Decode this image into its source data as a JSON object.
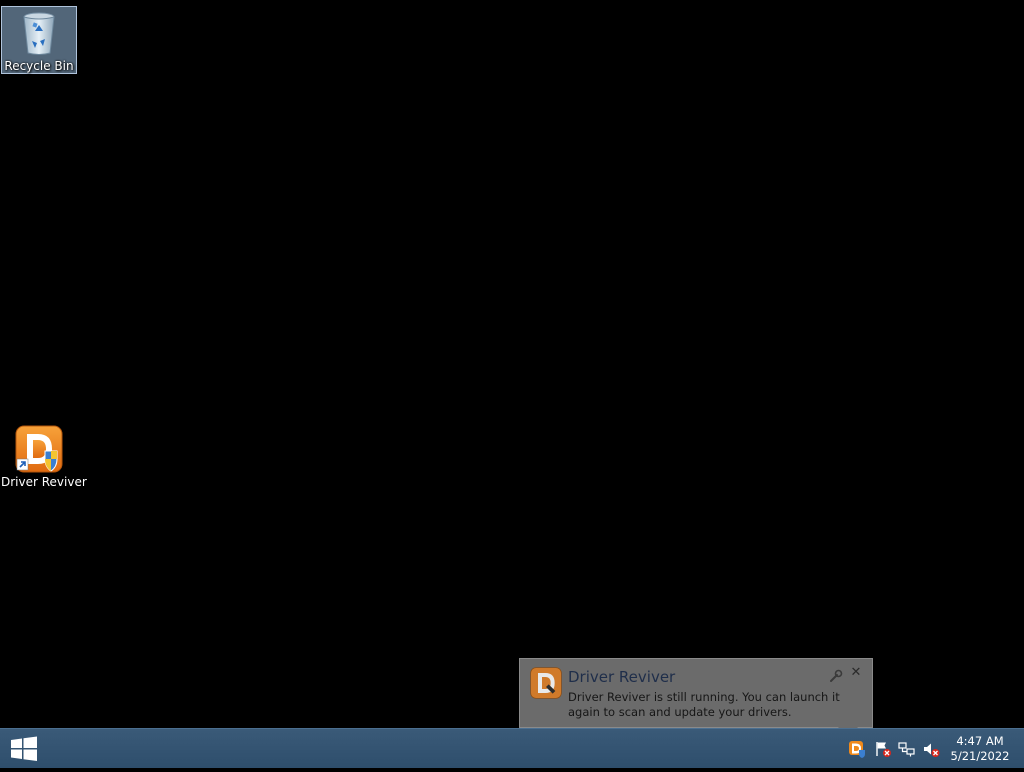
{
  "desktop": {
    "icons": [
      {
        "label": "Recycle Bin",
        "icon": "recycle-bin-icon"
      },
      {
        "label": "Driver Reviver",
        "icon": "driver-reviver-icon"
      }
    ]
  },
  "notification": {
    "app_icon": "driver-reviver-icon",
    "title": "Driver Reviver",
    "body": "Driver Reviver is still running. You can launch it again to scan and update your drivers.",
    "options_icon": "wrench-icon",
    "close_icon": "close-icon",
    "close_glyph": "✕"
  },
  "taskbar": {
    "start_icon": "windows-logo-icon",
    "tray": [
      {
        "icon": "driver-reviver-tray-icon"
      },
      {
        "icon": "action-center-flag-icon"
      },
      {
        "icon": "network-icon"
      },
      {
        "icon": "volume-muted-icon"
      }
    ],
    "clock": {
      "time": "4:47 AM",
      "date": "5/21/2022"
    }
  },
  "colors": {
    "desktop_background": "#000000",
    "taskbar": "#335372",
    "balloon": "#6b6b6b",
    "brand_orange": "#f08a1c"
  }
}
